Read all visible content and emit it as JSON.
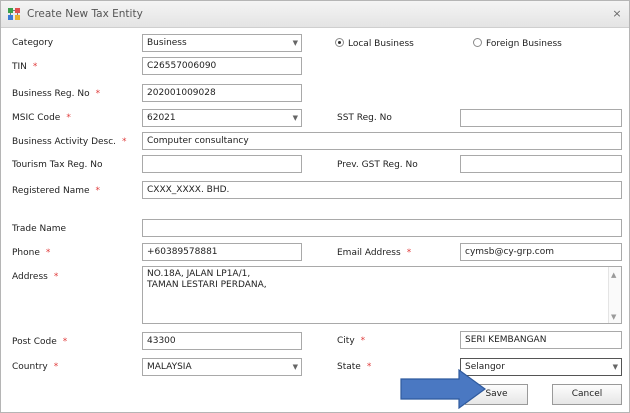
{
  "window": {
    "title": "Create New Tax Entity",
    "close_glyph": "×"
  },
  "form": {
    "category": {
      "label": "Category",
      "value": "Business"
    },
    "business_type": {
      "local_label": "Local Business",
      "foreign_label": "Foreign Business",
      "selected": "local"
    },
    "tin": {
      "label": "TIN",
      "value": "C26557006090"
    },
    "business_reg_no": {
      "label": "Business Reg. No",
      "value": "202001009028"
    },
    "msic_code": {
      "label": "MSIC Code",
      "value": "62021"
    },
    "sst_reg_no": {
      "label": "SST Reg. No",
      "value": ""
    },
    "business_activity": {
      "label": "Business Activity Desc.",
      "value": "Computer consultancy"
    },
    "tourism_tax_reg_no": {
      "label": "Tourism Tax Reg. No",
      "value": ""
    },
    "prev_gst_reg_no": {
      "label": "Prev. GST Reg. No",
      "value": ""
    },
    "registered_name": {
      "label": "Registered Name",
      "value": "CXXX_XXXX. BHD."
    },
    "trade_name": {
      "label": "Trade Name",
      "value": ""
    },
    "phone": {
      "label": "Phone",
      "value": "+60389578881"
    },
    "email": {
      "label": "Email Address",
      "value": "cymsb@cy-grp.com"
    },
    "address": {
      "label": "Address",
      "line1": "NO.18A, JALAN LP1A/1,",
      "line2": "TAMAN LESTARI PERDANA,"
    },
    "post_code": {
      "label": "Post Code",
      "value": "43300"
    },
    "city": {
      "label": "City",
      "value": "SERI KEMBANGAN"
    },
    "country": {
      "label": "Country",
      "value": "MALAYSIA"
    },
    "state": {
      "label": "State",
      "value": "Selangor"
    },
    "required_marker": "*"
  },
  "buttons": {
    "save": "Save",
    "cancel": "Cancel"
  },
  "colors": {
    "required": "#e03c3c",
    "pointer_arrow": "#4a78c2",
    "border": "#a9a9a9"
  },
  "icons": {
    "title": "tree-app-icon",
    "dropdown": "chevron-down-icon",
    "close": "close-icon",
    "pointer": "arrow-pointer-icon"
  }
}
